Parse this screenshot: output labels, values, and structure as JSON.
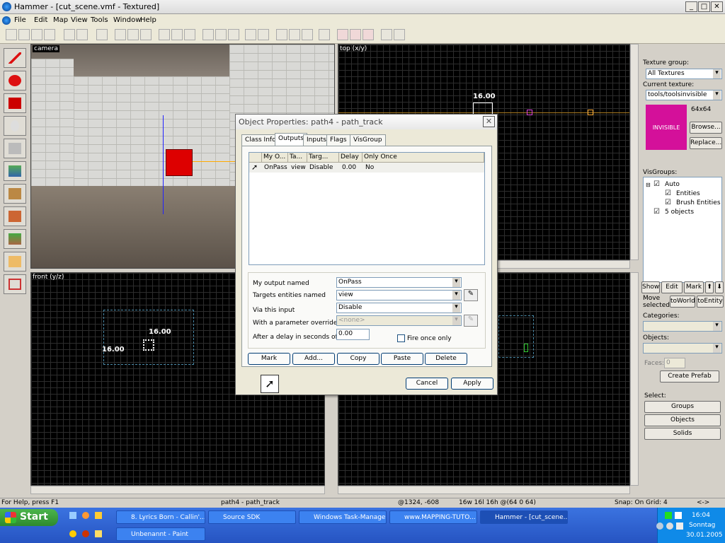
{
  "window": {
    "title": "Hammer - [cut_scene.vmf - Textured]",
    "btn_min": "_",
    "btn_max": "□",
    "btn_close": "✕"
  },
  "menu": [
    "File",
    "Edit",
    "Map",
    "View",
    "Tools",
    "Window",
    "Help"
  ],
  "views": {
    "camera": "camera",
    "top": "top (x/y)",
    "front": "front (y/z)"
  },
  "measures": {
    "top_w": "16.00",
    "top_h": "16.00",
    "front_w": "16.00",
    "front_h": "16.00"
  },
  "right_panel": {
    "texture_group_label": "Texture group:",
    "texture_group_value": "All Textures",
    "current_texture_label": "Current texture:",
    "current_texture_value": "tools/toolsinvisible",
    "texture_size": "64x64",
    "texture_preview_text": "INVISIBLE",
    "browse": "Browse...",
    "replace": "Replace...",
    "visgroups_label": "VisGroups:",
    "vis_auto": "Auto",
    "vis_entities": "Entities",
    "vis_brush": "Brush Entities",
    "vis_objects": "5 objects",
    "show": "Show",
    "edit": "Edit",
    "mark": "Mark",
    "up": "⬆",
    "down": "⬇",
    "move_selected": "Move selected:",
    "to_world": "toWorld",
    "to_entity": "toEntity",
    "categories_label": "Categories:",
    "objects_label": "Objects:",
    "faces_label": "Faces:",
    "faces_value": "0",
    "create_prefab": "Create Prefab",
    "select_label": "Select:",
    "groups": "Groups",
    "objects_btn": "Objects",
    "solids": "Solids"
  },
  "dialog": {
    "title": "Object Properties: path4 - path_track",
    "close": "✕",
    "tabs": [
      "Class Info",
      "Outputs",
      "Inputs",
      "Flags",
      "VisGroup"
    ],
    "columns": [
      "My O...",
      "Ta...",
      "Targ...",
      "Delay",
      "Only Once"
    ],
    "row": {
      "output": "OnPass",
      "target": "view",
      "input": "Disable",
      "delay": "0.00",
      "once": "No"
    },
    "my_output_label": "My output named",
    "my_output_value": "OnPass",
    "targets_label": "Targets entities named",
    "targets_value": "view",
    "via_label": "Via this input",
    "via_value": "Disable",
    "param_label": "With a parameter override of",
    "param_value": "<none>",
    "delay_label": "After a delay in seconds of",
    "delay_value": "0.00",
    "fire_once": "Fire once only",
    "buttons": [
      "Mark",
      "Add...",
      "Copy",
      "Paste",
      "Delete"
    ],
    "cancel": "Cancel",
    "apply": "Apply"
  },
  "status": {
    "help": "For Help, press F1",
    "selection": "path4 - path_track",
    "coords": "@1324, -608",
    "size": "16w 16l 16h @(64 0 64)",
    "snap": "Snap: On Grid: 4",
    "arrows": "<->"
  },
  "taskbar": {
    "start": "Start",
    "tasks": [
      "8. Lyrics Born - Callin'...",
      "Source SDK",
      "Windows Task-Manager",
      "www.MAPPING-TUTO...",
      "Hammer - [cut_scene...",
      "Unbenannt - Paint"
    ],
    "time": "16:04",
    "day": "Sonntag",
    "date": "30.01.2005"
  }
}
